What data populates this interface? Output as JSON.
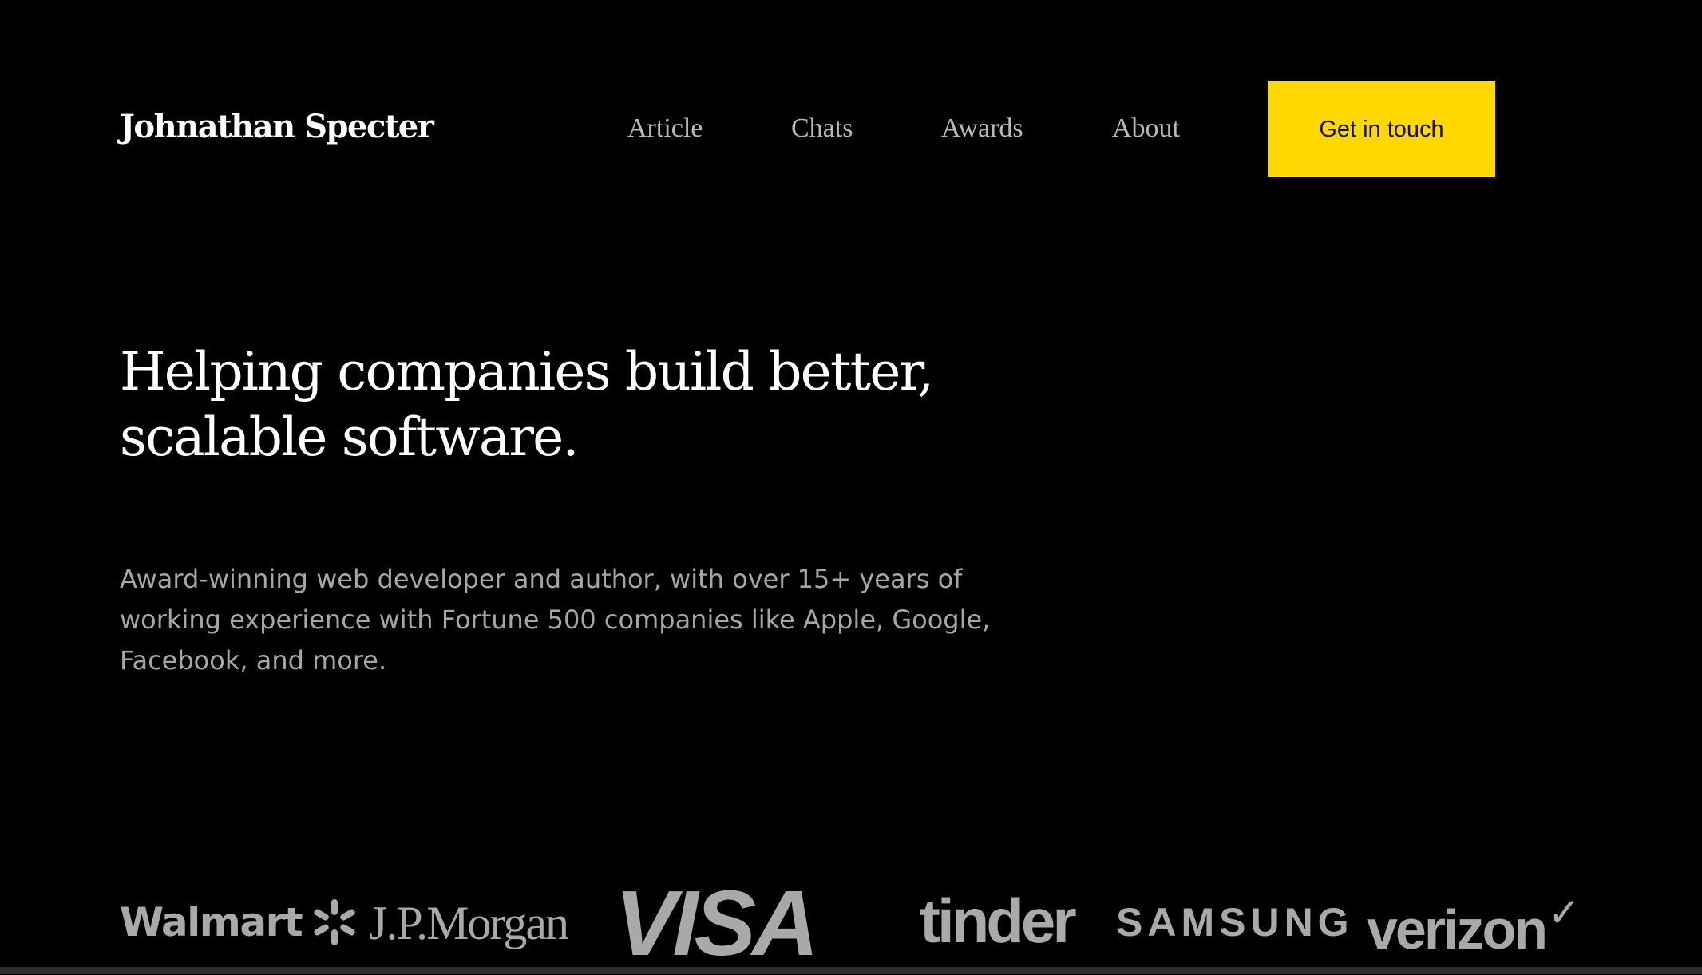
{
  "header": {
    "brand": "Johnathan Specter",
    "nav": {
      "article": "Article",
      "chats": "Chats",
      "awards": "Awards",
      "about": "About"
    },
    "cta_label": "Get in touch",
    "cta_color": "#ffd800"
  },
  "hero": {
    "title_lines": [
      "Helping companies build better,",
      "scalable software."
    ],
    "subtitle_lines": [
      "Award-winning web developer and author, with over 15+ years of",
      "working experience with Fortune 500 companies like Apple, Google,",
      "Facebook, and more."
    ]
  },
  "logos": {
    "walmart": "Walmart",
    "walmart_icon": "walmart-spark-icon",
    "jpmorgan": "J.P.Morgan",
    "visa": "VISA",
    "tinder": "tinder",
    "samsung": "SAMSUNG",
    "verizon": "verizon",
    "verizon_icon": "verizon-checkmark-icon",
    "logo_color": "#a9a9a9"
  },
  "colors": {
    "background": "#000000",
    "nav_text": "#b8b8b8",
    "body_text": "#a6a6a6"
  }
}
